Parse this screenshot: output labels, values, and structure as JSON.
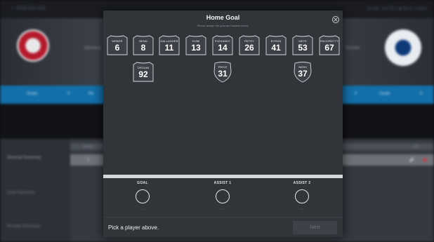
{
  "background": {
    "top_left_label": "< PRESSURE",
    "top_right_label": "GAME NOTES ▮ BOX LOGS",
    "home_team_label": "Montreal",
    "away_team_label": "Toronto",
    "blue_bar_left": [
      "Goals",
      "0",
      "Pe"
    ],
    "blue_bar_right": [
      "0",
      "Goals",
      "0"
    ],
    "side_items": [
      "General Summary",
      "Goal Summary",
      "Penalty Summary"
    ],
    "table_header_left": "PERIOD",
    "table_header_right": "EDIT",
    "table_row_value": "1"
  },
  "modal": {
    "title": "Home Goal",
    "subtitle": "Please assign the goal and assists below.",
    "close_icon": "close-icon",
    "players": [
      {
        "name": "WEBER",
        "number": "6",
        "type": "skater"
      },
      {
        "name": "BENN",
        "number": "8",
        "type": "skater"
      },
      {
        "name": "GALLAGHER",
        "number": "11",
        "type": "skater"
      },
      {
        "name": "DOMI",
        "number": "13",
        "type": "skater"
      },
      {
        "name": "PLEKANEC",
        "number": "14",
        "type": "skater"
      },
      {
        "name": "PETRY",
        "number": "26",
        "type": "skater"
      },
      {
        "name": "BYRON",
        "number": "41",
        "type": "skater"
      },
      {
        "name": "METE",
        "number": "53",
        "type": "skater"
      },
      {
        "name": "PACIORETTY",
        "number": "67",
        "type": "skater"
      },
      {
        "name": "DROUIN",
        "number": "92",
        "type": "skater"
      },
      {
        "name": "PRICE",
        "number": "31",
        "type": "goalie"
      },
      {
        "name": "NIEMI",
        "number": "37",
        "type": "goalie"
      }
    ],
    "slots": [
      {
        "label": "GOAL",
        "placeholder": "..."
      },
      {
        "label": "ASSIST 1",
        "placeholder": "..."
      },
      {
        "label": "ASSIST 2",
        "placeholder": "..."
      }
    ],
    "footer_message": "Pick a player above.",
    "next_label": "Next"
  },
  "colors": {
    "modal_bg": "#313438",
    "accent_blue": "#136fa8",
    "home_red": "#b51a2c",
    "away_blue": "#0e3a7a"
  }
}
